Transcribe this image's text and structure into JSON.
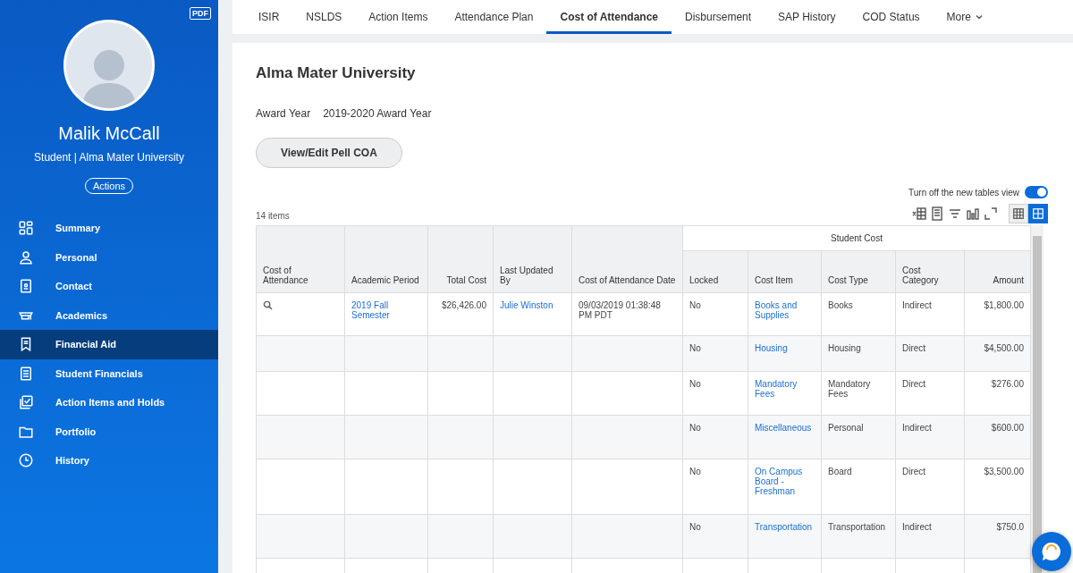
{
  "sidebar": {
    "pdf_label": "PDF",
    "profile": {
      "name": "Malik McCall",
      "subtitle": "Student | Alma Mater University",
      "actions": "Actions"
    },
    "items": [
      {
        "label": "Summary",
        "selected": false
      },
      {
        "label": "Personal",
        "selected": false
      },
      {
        "label": "Contact",
        "selected": false
      },
      {
        "label": "Academics",
        "selected": false
      },
      {
        "label": "Financial Aid",
        "selected": true
      },
      {
        "label": "Student Financials",
        "selected": false
      },
      {
        "label": "Action Items and Holds",
        "selected": false
      },
      {
        "label": "Portfolio",
        "selected": false
      },
      {
        "label": "History",
        "selected": false
      }
    ]
  },
  "tabs": [
    {
      "label": "ISIR",
      "selected": false
    },
    {
      "label": "NSLDS",
      "selected": false
    },
    {
      "label": "Action Items",
      "selected": false
    },
    {
      "label": "Attendance Plan",
      "selected": false
    },
    {
      "label": "Cost of Attendance",
      "selected": true
    },
    {
      "label": "Disbursement",
      "selected": false
    },
    {
      "label": "SAP History",
      "selected": false
    },
    {
      "label": "COD Status",
      "selected": false
    },
    {
      "label": "More",
      "selected": false,
      "kind": "menu"
    }
  ],
  "content": {
    "title": "Alma Mater University",
    "award_year": {
      "label": "Award Year",
      "value": "2019-2020 Award Year"
    },
    "pell_button": "View/Edit Pell COA",
    "tables_toggle": {
      "label": "Turn off the new tables view",
      "on": true
    },
    "item_count": "14 items",
    "views": [
      {
        "selected": false
      },
      {
        "selected": true
      }
    ],
    "table": {
      "group_header": "Student Cost",
      "columns": [
        "Cost of Attendance",
        "Academic Period",
        "Total Cost",
        "Last Updated By",
        "Cost of Attendance Date",
        "Locked",
        "Cost Item",
        "Cost Type",
        "Cost Category",
        "Amount"
      ],
      "rows": [
        {
          "academic_period": "2019 Fall Semester",
          "total_cost": "$26,426.00",
          "last_updated_by": "Julie Winston",
          "date": "09/03/2019 01:38:48 PM PDT",
          "locked": "No",
          "cost_item": "Books and Supplies",
          "cost_type": "Books",
          "cost_category": "Indirect",
          "amount": "$1,800.00"
        },
        {
          "locked": "No",
          "cost_item": "Housing",
          "cost_type": "Housing",
          "cost_category": "Direct",
          "amount": "$4,500.00"
        },
        {
          "locked": "No",
          "cost_item": "Mandatory Fees",
          "cost_type": "Mandatory Fees",
          "cost_category": "Direct",
          "amount": "$276.00"
        },
        {
          "locked": "No",
          "cost_item": "Miscellaneous",
          "cost_type": "Personal",
          "cost_category": "Indirect",
          "amount": "$600.00"
        },
        {
          "locked": "No",
          "cost_item": "On Campus Board - Freshman",
          "cost_type": "Board",
          "cost_category": "Direct",
          "amount": "$3,500.00"
        },
        {
          "locked": "No",
          "cost_item": "Transportation",
          "cost_type": "Transportation",
          "cost_category": "Indirect",
          "amount": "$750.0"
        }
      ]
    }
  }
}
